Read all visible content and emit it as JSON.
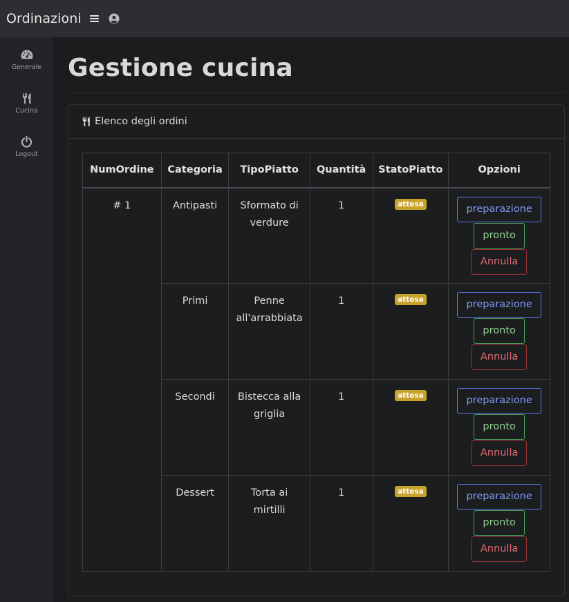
{
  "app": {
    "brand": "Ordinazioni"
  },
  "sidebar": {
    "items": [
      {
        "label": "Generale",
        "icon": "tachometer-icon"
      },
      {
        "label": "Cucina",
        "icon": "utensils-icon"
      },
      {
        "label": "Logout",
        "icon": "power-icon"
      }
    ]
  },
  "page": {
    "title": "Gestione cucina"
  },
  "card": {
    "title": "Elenco degli ordini"
  },
  "table": {
    "headers": [
      "NumOrdine",
      "Categoria",
      "TipoPiatto",
      "Quantità",
      "StatoPiatto",
      "Opzioni"
    ],
    "order_number": "# 1",
    "rows": [
      {
        "categoria": "Antipasti",
        "tipo": "Sformato di verdure",
        "quantita": "1",
        "stato": "attesa"
      },
      {
        "categoria": "Primi",
        "tipo": "Penne all'arrabbiata",
        "quantita": "1",
        "stato": "attesa"
      },
      {
        "categoria": "Secondi",
        "tipo": "Bistecca alla griglia",
        "quantita": "1",
        "stato": "attesa"
      },
      {
        "categoria": "Dessert",
        "tipo": "Torta ai mirtilli",
        "quantita": "1",
        "stato": "attesa"
      }
    ],
    "buttons": {
      "prep": "preparazione",
      "ready": "pronto",
      "cancel": "Annulla"
    }
  },
  "colors": {
    "topbar": "#2c2e31",
    "sidebar": "#232427",
    "background": "#1b1c1e",
    "badge_waiting": "#c8a22b",
    "btn_primary": "#5a7be8",
    "btn_success": "#4fa05a",
    "btn_danger": "#9c3338"
  }
}
